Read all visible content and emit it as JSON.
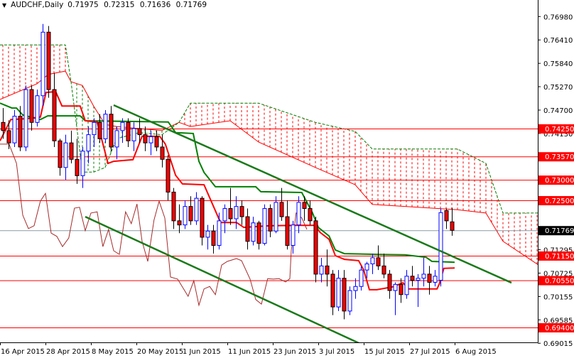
{
  "header": {
    "symbol_icon": "triangle-down-icon",
    "symbol": "AUDCHF,Daily",
    "open": "0.71975",
    "high": "0.72315",
    "low": "0.71636",
    "close": "0.71769"
  },
  "chart_data": {
    "type": "candlestick",
    "title": "AUDCHF,Daily",
    "ylim": [
      0.6885,
      0.774
    ],
    "colors": {
      "bull": "#0000ff",
      "bear": "#ff0000",
      "level": "#ff0000",
      "tenkan": "#ff0000",
      "kijun": "#008000",
      "chikou": "#a52a2a",
      "channel": "#1a7a1a",
      "current": "#8a9aa6"
    },
    "y_ticks": [
      "0.76980",
      "0.76410",
      "0.75840",
      "0.75270",
      "0.74700",
      "0.74130",
      "0.71295",
      "0.70725",
      "0.70155",
      "0.69585",
      "0.69015"
    ],
    "x_ticks": [
      {
        "label": "16 Apr 2015",
        "bar": 0
      },
      {
        "label": "28 Apr 2015",
        "bar": 8
      },
      {
        "label": "8 May 2015",
        "bar": 16
      },
      {
        "label": "20 May 2015",
        "bar": 24
      },
      {
        "label": "1 Jun 2015",
        "bar": 32
      },
      {
        "label": "11 Jun 2015",
        "bar": 40
      },
      {
        "label": "23 Jun 2015",
        "bar": 48
      },
      {
        "label": "3 Jul 2015",
        "bar": 56
      },
      {
        "label": "15 Jul 2015",
        "bar": 64
      },
      {
        "label": "27 Jul 2015",
        "bar": 72
      },
      {
        "label": "6 Aug 2015",
        "bar": 80
      }
    ],
    "levels": [
      "0.74250",
      "0.73570",
      "0.73000",
      "0.72500",
      "0.71150",
      "0.70550",
      "0.69400"
    ],
    "current_price": "0.71769",
    "ohlc": [
      [
        0.744,
        0.7475,
        0.74,
        0.742
      ],
      [
        0.742,
        0.7445,
        0.7375,
        0.739
      ],
      [
        0.739,
        0.747,
        0.738,
        0.7455
      ],
      [
        0.7455,
        0.748,
        0.737,
        0.738
      ],
      [
        0.738,
        0.753,
        0.737,
        0.752
      ],
      [
        0.752,
        0.753,
        0.742,
        0.744
      ],
      [
        0.744,
        0.752,
        0.743,
        0.7505
      ],
      [
        0.7505,
        0.768,
        0.748,
        0.766
      ],
      [
        0.766,
        0.7675,
        0.75,
        0.752
      ],
      [
        0.752,
        0.756,
        0.738,
        0.7395
      ],
      [
        0.7395,
        0.74,
        0.731,
        0.733
      ],
      [
        0.733,
        0.741,
        0.73,
        0.739
      ],
      [
        0.739,
        0.742,
        0.734,
        0.735
      ],
      [
        0.735,
        0.74,
        0.729,
        0.731
      ],
      [
        0.731,
        0.738,
        0.728,
        0.737
      ],
      [
        0.737,
        0.743,
        0.734,
        0.741
      ],
      [
        0.741,
        0.745,
        0.738,
        0.744
      ],
      [
        0.744,
        0.746,
        0.739,
        0.74
      ],
      [
        0.74,
        0.747,
        0.739,
        0.746
      ],
      [
        0.746,
        0.748,
        0.737,
        0.738
      ],
      [
        0.738,
        0.743,
        0.735,
        0.742
      ],
      [
        0.742,
        0.745,
        0.739,
        0.744
      ],
      [
        0.744,
        0.745,
        0.738,
        0.7395
      ],
      [
        0.7395,
        0.744,
        0.737,
        0.7425
      ],
      [
        0.7425,
        0.745,
        0.739,
        0.741
      ],
      [
        0.741,
        0.743,
        0.737,
        0.739
      ],
      [
        0.739,
        0.742,
        0.736,
        0.7405
      ],
      [
        0.7405,
        0.742,
        0.737,
        0.738
      ],
      [
        0.738,
        0.741,
        0.733,
        0.735
      ],
      [
        0.735,
        0.736,
        0.725,
        0.727
      ],
      [
        0.727,
        0.728,
        0.718,
        0.72
      ],
      [
        0.72,
        0.724,
        0.717,
        0.719
      ],
      [
        0.719,
        0.725,
        0.718,
        0.7235
      ],
      [
        0.7235,
        0.726,
        0.719,
        0.72
      ],
      [
        0.72,
        0.727,
        0.719,
        0.7255
      ],
      [
        0.7255,
        0.726,
        0.714,
        0.716
      ],
      [
        0.716,
        0.719,
        0.713,
        0.7175
      ],
      [
        0.7175,
        0.719,
        0.712,
        0.714
      ],
      [
        0.714,
        0.722,
        0.713,
        0.72
      ],
      [
        0.72,
        0.724,
        0.717,
        0.723
      ],
      [
        0.723,
        0.728,
        0.719,
        0.7205
      ],
      [
        0.7205,
        0.726,
        0.718,
        0.7235
      ],
      [
        0.7235,
        0.725,
        0.719,
        0.721
      ],
      [
        0.721,
        0.723,
        0.713,
        0.715
      ],
      [
        0.715,
        0.721,
        0.714,
        0.7195
      ],
      [
        0.7195,
        0.72,
        0.713,
        0.7145
      ],
      [
        0.7145,
        0.724,
        0.714,
        0.723
      ],
      [
        0.723,
        0.724,
        0.716,
        0.7175
      ],
      [
        0.7175,
        0.726,
        0.717,
        0.7245
      ],
      [
        0.7245,
        0.728,
        0.72,
        0.721
      ],
      [
        0.721,
        0.725,
        0.713,
        0.714
      ],
      [
        0.714,
        0.72,
        0.712,
        0.719
      ],
      [
        0.719,
        0.726,
        0.717,
        0.7245
      ],
      [
        0.7245,
        0.726,
        0.72,
        0.723
      ],
      [
        0.723,
        0.725,
        0.719,
        0.72
      ],
      [
        0.72,
        0.721,
        0.705,
        0.707
      ],
      [
        0.707,
        0.711,
        0.705,
        0.709
      ],
      [
        0.709,
        0.713,
        0.704,
        0.707
      ],
      [
        0.707,
        0.708,
        0.697,
        0.699
      ],
      [
        0.699,
        0.708,
        0.698,
        0.706
      ],
      [
        0.706,
        0.708,
        0.696,
        0.698
      ],
      [
        0.698,
        0.704,
        0.697,
        0.703
      ],
      [
        0.703,
        0.706,
        0.701,
        0.704
      ],
      [
        0.704,
        0.709,
        0.703,
        0.708
      ],
      [
        0.708,
        0.71,
        0.706,
        0.7095
      ],
      [
        0.7095,
        0.712,
        0.707,
        0.711
      ],
      [
        0.711,
        0.714,
        0.708,
        0.709
      ],
      [
        0.709,
        0.712,
        0.706,
        0.707
      ],
      [
        0.707,
        0.708,
        0.701,
        0.703
      ],
      [
        0.703,
        0.705,
        0.697,
        0.7045
      ],
      [
        0.7045,
        0.706,
        0.7,
        0.702
      ],
      [
        0.702,
        0.708,
        0.701,
        0.7065
      ],
      [
        0.7065,
        0.709,
        0.704,
        0.7055
      ],
      [
        0.7055,
        0.707,
        0.699,
        0.706
      ],
      [
        0.706,
        0.711,
        0.704,
        0.707
      ],
      [
        0.707,
        0.709,
        0.702,
        0.705
      ],
      [
        0.705,
        0.708,
        0.704,
        0.7065
      ],
      [
        0.7055,
        0.723,
        0.704,
        0.722
      ],
      [
        0.7225,
        0.723,
        0.718,
        0.72
      ],
      [
        0.71975,
        0.72315,
        0.71636,
        0.71769
      ]
    ],
    "tenkan": [
      [
        -0.5,
        0.7395
      ],
      [
        1.4,
        0.7447
      ],
      [
        4.1,
        0.7449
      ],
      [
        6.6,
        0.7453
      ],
      [
        7.6,
        0.7513
      ],
      [
        9.3,
        0.7515
      ],
      [
        10.4,
        0.748
      ],
      [
        13.6,
        0.748
      ],
      [
        14.5,
        0.7444
      ],
      [
        16.6,
        0.7441
      ],
      [
        18.5,
        0.734
      ],
      [
        19.5,
        0.7345
      ],
      [
        22.9,
        0.7349
      ],
      [
        24.5,
        0.7406
      ],
      [
        27.6,
        0.7406
      ],
      [
        28.6,
        0.7387
      ],
      [
        30.4,
        0.7311
      ],
      [
        31.6,
        0.729
      ],
      [
        35.4,
        0.7288
      ],
      [
        38.3,
        0.7196
      ],
      [
        41.1,
        0.7196
      ],
      [
        42.4,
        0.7184
      ],
      [
        47,
        0.7188
      ],
      [
        52,
        0.7189
      ],
      [
        54.9,
        0.7189
      ],
      [
        55.8,
        0.7172
      ],
      [
        57.4,
        0.7155
      ],
      [
        58.5,
        0.7115
      ],
      [
        60.1,
        0.7106
      ],
      [
        62.6,
        0.7103
      ],
      [
        63.5,
        0.708
      ],
      [
        64.5,
        0.7032
      ],
      [
        65.8,
        0.7032
      ],
      [
        68.6,
        0.7039
      ],
      [
        70.4,
        0.7049
      ],
      [
        71.4,
        0.7034
      ],
      [
        76.4,
        0.7034
      ],
      [
        76.8,
        0.7046
      ],
      [
        77.6,
        0.7084
      ],
      [
        79.5,
        0.7085
      ]
    ],
    "kijun": [
      [
        -0.5,
        0.7487
      ],
      [
        1.6,
        0.7475
      ],
      [
        2.4,
        0.7475
      ],
      [
        3.5,
        0.7458
      ],
      [
        6.6,
        0.7447
      ],
      [
        7.9,
        0.7456
      ],
      [
        13.6,
        0.7456
      ],
      [
        14.5,
        0.7444
      ],
      [
        29.1,
        0.7441
      ],
      [
        30.4,
        0.7415
      ],
      [
        33.5,
        0.7413
      ],
      [
        34.5,
        0.7345
      ],
      [
        35.4,
        0.7318
      ],
      [
        37.4,
        0.7283
      ],
      [
        44.5,
        0.7283
      ],
      [
        45.4,
        0.7271
      ],
      [
        52.6,
        0.7269
      ],
      [
        54.5,
        0.7219
      ],
      [
        55.5,
        0.7184
      ],
      [
        57.4,
        0.7163
      ],
      [
        58.5,
        0.7129
      ],
      [
        60.1,
        0.712
      ],
      [
        66.6,
        0.7118
      ],
      [
        70.8,
        0.7117
      ],
      [
        74.5,
        0.7111
      ],
      [
        75.5,
        0.7101
      ],
      [
        79.5,
        0.7099
      ]
    ],
    "chikou": [
      [
        -0.5,
        0.7387
      ],
      [
        1.1,
        0.7387
      ],
      [
        2.4,
        0.734
      ],
      [
        3.5,
        0.7214
      ],
      [
        4.5,
        0.7181
      ],
      [
        5.5,
        0.7188
      ],
      [
        6.6,
        0.7248
      ],
      [
        7.5,
        0.7267
      ],
      [
        8.5,
        0.717
      ],
      [
        9.5,
        0.7162
      ],
      [
        10.5,
        0.7137
      ],
      [
        11.6,
        0.7158
      ],
      [
        12.6,
        0.7231
      ],
      [
        13.5,
        0.7233
      ],
      [
        14.5,
        0.7176
      ],
      [
        15.5,
        0.7219
      ],
      [
        16.6,
        0.7222
      ],
      [
        17.6,
        0.7137
      ],
      [
        18.6,
        0.7179
      ],
      [
        19.5,
        0.7127
      ],
      [
        20.5,
        0.7118
      ],
      [
        21.6,
        0.7222
      ],
      [
        22.6,
        0.7193
      ],
      [
        23.6,
        0.7241
      ],
      [
        24.5,
        0.715
      ],
      [
        25.5,
        0.7101
      ],
      [
        26.6,
        0.7202
      ],
      [
        27.5,
        0.7248
      ],
      [
        28.5,
        0.7207
      ],
      [
        29.5,
        0.7063
      ],
      [
        30.75,
        0.7058
      ],
      [
        32.6,
        0.7016
      ],
      [
        33.6,
        0.7054
      ],
      [
        34.5,
        0.6994
      ],
      [
        35.4,
        0.7034
      ],
      [
        36.4,
        0.704
      ],
      [
        37.4,
        0.702
      ],
      [
        38.5,
        0.7092
      ],
      [
        39.5,
        0.7101
      ],
      [
        41.1,
        0.7108
      ],
      [
        42,
        0.7103
      ],
      [
        43.5,
        0.7058
      ],
      [
        44.5,
        0.7008
      ],
      [
        45.5,
        0.6997
      ],
      [
        46.6,
        0.7059
      ],
      [
        47.6,
        0.7058
      ],
      [
        48.6,
        0.7059
      ],
      [
        49.75,
        0.7051
      ],
      [
        50.5,
        0.7059
      ],
      [
        50.75,
        0.7127
      ],
      [
        51.6,
        0.7219
      ],
      [
        52.6,
        0.7207
      ],
      [
        53.5,
        0.7179
      ]
    ],
    "cloud": [
      [
        -0.5,
        0.7496,
        0.7629
      ],
      [
        6,
        0.7534,
        0.7629
      ],
      [
        8,
        0.7557,
        0.7629
      ],
      [
        11,
        0.7565,
        0.7629
      ],
      [
        12,
        0.7539,
        0.7539
      ],
      [
        14,
        0.753,
        0.7319
      ],
      [
        16,
        0.7479,
        0.7319
      ],
      [
        18,
        0.7435,
        0.733
      ],
      [
        20,
        0.743,
        0.74
      ],
      [
        24,
        0.7425,
        0.7415
      ],
      [
        28,
        0.742,
        0.741
      ],
      [
        31,
        0.744,
        0.744
      ],
      [
        33,
        0.743,
        0.7487
      ],
      [
        40,
        0.7444,
        0.7487
      ],
      [
        45,
        0.7392,
        0.7487
      ],
      [
        55,
        0.733,
        0.744
      ],
      [
        62,
        0.7288,
        0.7418
      ],
      [
        65,
        0.724,
        0.7375
      ],
      [
        80,
        0.7227,
        0.7375
      ],
      [
        85,
        0.7219,
        0.734
      ],
      [
        88,
        0.715,
        0.7219
      ],
      [
        94.5,
        0.709,
        0.7219
      ]
    ],
    "channel_lines": [
      {
        "name": "upper-channel",
        "from": [
          19.5,
          0.7482
        ],
        "to": [
          89.5,
          0.7049
        ]
      },
      {
        "name": "lower-channel",
        "from": [
          14.5,
          0.721
        ],
        "to": [
          68.25,
          0.6866
        ]
      }
    ]
  }
}
